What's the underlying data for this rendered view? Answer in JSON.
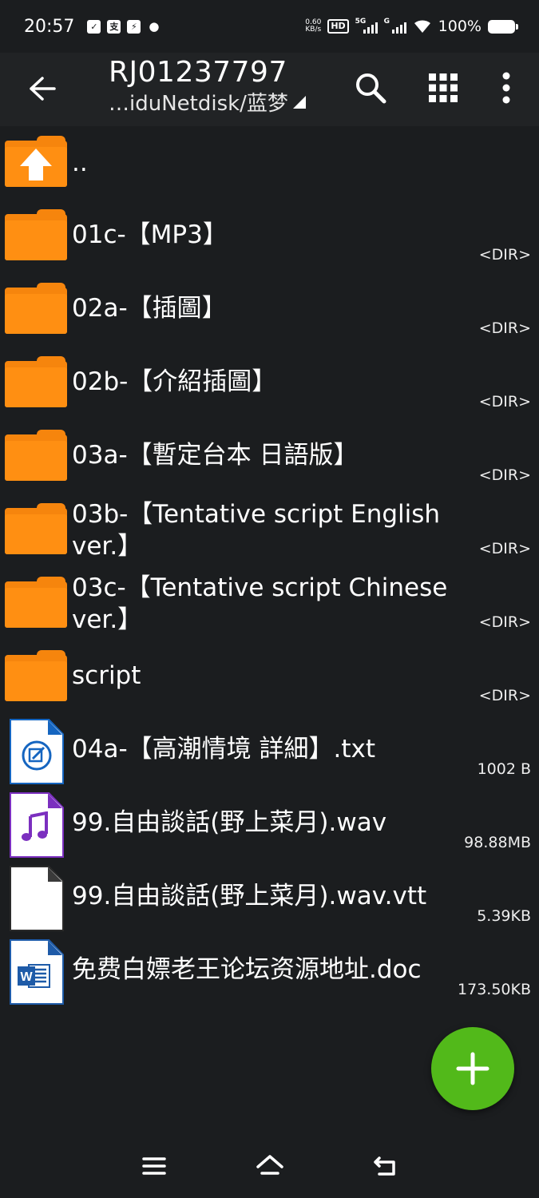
{
  "status_bar": {
    "time": "20:57",
    "net_speed_value": "0.60",
    "net_speed_unit": "KB/s",
    "hd_label": "HD",
    "signal1_label": "5G",
    "signal2_label": "G",
    "battery_percent": "100%"
  },
  "toolbar": {
    "title": "RJ01237797",
    "subtitle": "…iduNetdisk/蓝梦",
    "icons": [
      "back-arrow-icon",
      "search-icon",
      "grid-view-icon",
      "more-vert-icon"
    ]
  },
  "files": [
    {
      "name": "..",
      "meta": "",
      "icon": "folder-up-icon",
      "type": "parent"
    },
    {
      "name": "01c-【MP3】",
      "meta": "<DIR>",
      "icon": "folder-icon",
      "type": "dir"
    },
    {
      "name": "02a-【插圖】",
      "meta": "<DIR>",
      "icon": "folder-icon",
      "type": "dir"
    },
    {
      "name": "02b-【介紹插圖】",
      "meta": "<DIR>",
      "icon": "folder-icon",
      "type": "dir"
    },
    {
      "name": "03a-【暫定台本 日語版】",
      "meta": "<DIR>",
      "icon": "folder-icon",
      "type": "dir"
    },
    {
      "name": "03b-【Tentative script English ver.】",
      "meta": "<DIR>",
      "icon": "folder-icon",
      "type": "dir"
    },
    {
      "name": "03c-【Tentative script Chinese ver.】",
      "meta": "<DIR>",
      "icon": "folder-icon",
      "type": "dir"
    },
    {
      "name": "script",
      "meta": "<DIR>",
      "icon": "folder-icon",
      "type": "dir"
    },
    {
      "name": "04a-【高潮情境 詳細】.txt",
      "meta": "1002 B",
      "icon": "text-file-icon",
      "type": "txt"
    },
    {
      "name": "99.自由談話(野上菜月).wav",
      "meta": "98.88MB",
      "icon": "audio-file-icon",
      "type": "audio"
    },
    {
      "name": "99.自由談話(野上菜月).wav.vtt",
      "meta": "5.39KB",
      "icon": "blank-file-icon",
      "type": "blank"
    },
    {
      "name": "免费白嫖老王论坛资源地址.doc",
      "meta": "173.50KB",
      "icon": "word-file-icon",
      "type": "word"
    }
  ],
  "fab": {
    "icon": "add-icon"
  },
  "navbar": {
    "icons": [
      "menu-icon",
      "home-icon",
      "back-icon"
    ]
  },
  "colors": {
    "background": "#1b1d1f",
    "toolbar": "#212325",
    "folder": "#ff8f12",
    "fab": "#52b91a",
    "txt_icon": "#1565c0",
    "audio_icon": "#7b2fbf",
    "word_icon": "#1e5ba8"
  }
}
